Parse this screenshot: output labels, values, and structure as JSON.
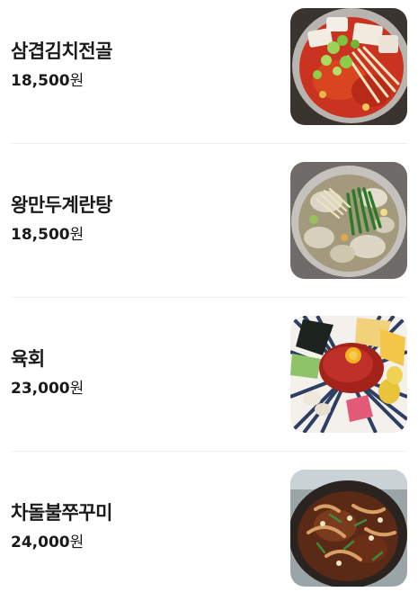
{
  "menu": {
    "items": [
      {
        "name": "삼겹김치전골",
        "price": "18,500",
        "currency": "원",
        "photo": "kimchi-stew-photo"
      },
      {
        "name": "왕만두계란탕",
        "price": "18,500",
        "currency": "원",
        "photo": "dumpling-soup-photo"
      },
      {
        "name": "육회",
        "price": "23,000",
        "currency": "원",
        "photo": "yukhoe-photo"
      },
      {
        "name": "차돌불쭈꾸미",
        "price": "24,000",
        "currency": "원",
        "photo": "stir-fried-octopus-photo"
      }
    ]
  }
}
